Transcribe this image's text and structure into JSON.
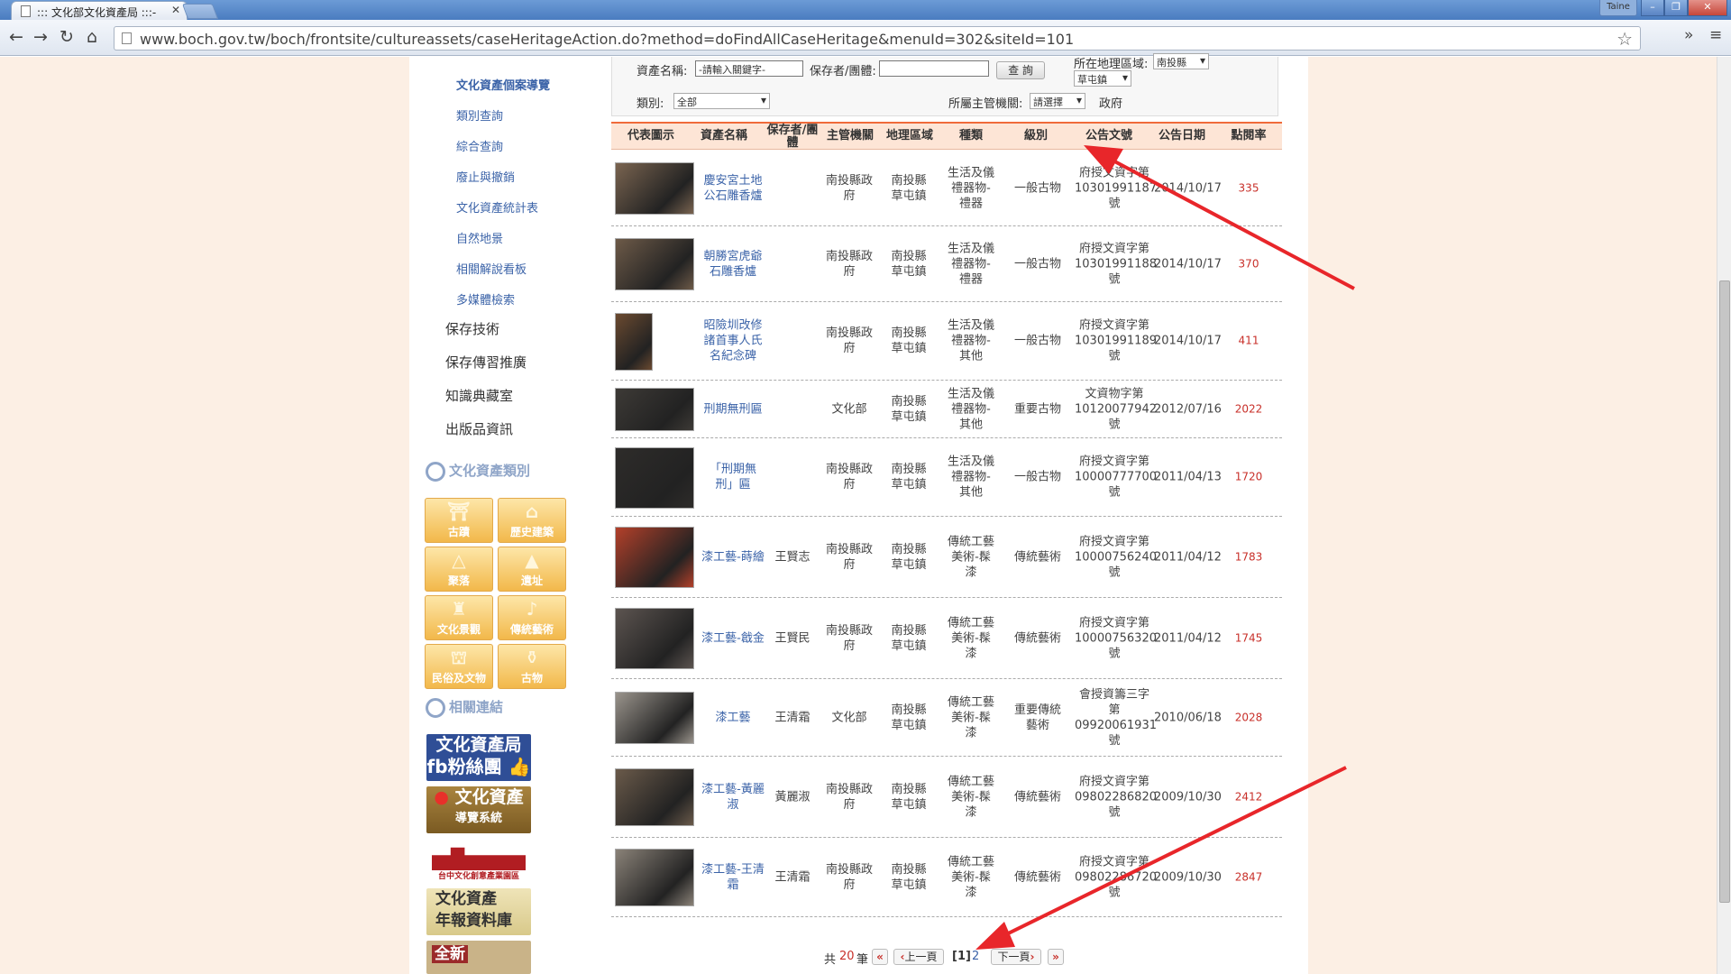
{
  "browser": {
    "tab_title": "::: 文化部文化資產局 :::-",
    "url": "www.boch.gov.tw/boch/frontsite/cultureassets/caseHeritageAction.do?method=doFindAllCaseHeritage&menuId=302&siteId=101",
    "user": "Taine"
  },
  "sidebar": {
    "sub_items": [
      "文化資產個案導覽",
      "類別查詢",
      "綜合查詢",
      "廢止與撤銷",
      "文化資產統計表",
      "自然地景",
      "相關解說看板",
      "多媒體檢索"
    ],
    "main_items": [
      "保存技術",
      "保存傳習推廣",
      "知識典藏室",
      "出版品資訊"
    ],
    "section_category": "文化資產類別",
    "categories": [
      "古蹟",
      "歷史建築",
      "聚落",
      "遺址",
      "文化景觀",
      "傳統藝術",
      "民俗及文物",
      "古物"
    ],
    "section_links": "相關連結",
    "banners": {
      "fb_line1": "文化資產局",
      "fb_line2": "fb粉絲團",
      "guide_line1": "文化資產",
      "guide_line2": "導覽系統",
      "library": "台中文化創意產業園區",
      "yearbook_line1": "文化資產",
      "yearbook_line2": "年報資料庫",
      "new": "全新"
    }
  },
  "filters": {
    "name_label": "資產名稱:",
    "name_placeholder": "-請輸入關鍵字-",
    "keeper_label": "保存者/團體:",
    "search_button": "查 詢",
    "region_label": "所在地理區域:",
    "county": "南投縣",
    "town": "草屯鎮",
    "category_label": "類別:",
    "category_value": "全部",
    "agency_label": "所屬主管機關:",
    "agency_value": "請選擇",
    "agency_text": "政府"
  },
  "table": {
    "headers": [
      "代表圖示",
      "資產名稱",
      "保存者/團體",
      "主管機關",
      "地理區域",
      "種類",
      "級別",
      "公告文號",
      "公告日期",
      "點閱率"
    ],
    "rows": [
      {
        "name": "慶安宮土地公石雕香爐",
        "keeper": "",
        "agency": "南投縣政府",
        "region": "南投縣草屯鎮",
        "type": "生活及儀禮器物-禮器",
        "level": "一般古物",
        "doc": "府授文資字第10301991187號",
        "date": "2014/10/17",
        "clicks": "335"
      },
      {
        "name": "朝勝宮虎爺石雕香爐",
        "keeper": "",
        "agency": "南投縣政府",
        "region": "南投縣草屯鎮",
        "type": "生活及儀禮器物-禮器",
        "level": "一般古物",
        "doc": "府授文資字第10301991188號",
        "date": "2014/10/17",
        "clicks": "370"
      },
      {
        "name": "昭險圳改修諸首事人氏名紀念碑",
        "keeper": "",
        "agency": "南投縣政府",
        "region": "南投縣草屯鎮",
        "type": "生活及儀禮器物-其他",
        "level": "一般古物",
        "doc": "府授文資字第10301991189號",
        "date": "2014/10/17",
        "clicks": "411"
      },
      {
        "name": "刑期無刑匾",
        "keeper": "",
        "agency": "文化部",
        "region": "南投縣草屯鎮",
        "type": "生活及儀禮器物-其他",
        "level": "重要古物",
        "doc": "文資物字第10120077942號",
        "date": "2012/07/16",
        "clicks": "2022"
      },
      {
        "name": "「刑期無刑」匾",
        "keeper": "",
        "agency": "南投縣政府",
        "region": "南投縣草屯鎮",
        "type": "生活及儀禮器物-其他",
        "level": "一般古物",
        "doc": "府授文資字第10000777700號",
        "date": "2011/04/13",
        "clicks": "1720"
      },
      {
        "name": "漆工藝-蒔繪",
        "keeper": "王賢志",
        "agency": "南投縣政府",
        "region": "南投縣草屯鎮",
        "type": "傳統工藝美術-髹漆",
        "level": "傳統藝術",
        "doc": "府授文資字第10000756240號",
        "date": "2011/04/12",
        "clicks": "1783"
      },
      {
        "name": "漆工藝-戧金",
        "keeper": "王賢民",
        "agency": "南投縣政府",
        "region": "南投縣草屯鎮",
        "type": "傳統工藝美術-髹漆",
        "level": "傳統藝術",
        "doc": "府授文資字第10000756320號",
        "date": "2011/04/12",
        "clicks": "1745"
      },
      {
        "name": "漆工藝",
        "keeper": "王清霜",
        "agency": "文化部",
        "region": "南投縣草屯鎮",
        "type": "傳統工藝美術-髹漆",
        "level": "重要傳統藝術",
        "doc": "會授資籌三字第09920061931號",
        "date": "2010/06/18",
        "clicks": "2028"
      },
      {
        "name": "漆工藝-黃麗淑",
        "keeper": "黃麗淑",
        "agency": "南投縣政府",
        "region": "南投縣草屯鎮",
        "type": "傳統工藝美術-髹漆",
        "level": "傳統藝術",
        "doc": "府授文資字第09802286820號",
        "date": "2009/10/30",
        "clicks": "2412"
      },
      {
        "name": "漆工藝-王清霜",
        "keeper": "王清霜",
        "agency": "南投縣政府",
        "region": "南投縣草屯鎮",
        "type": "傳統工藝美術-髹漆",
        "level": "傳統藝術",
        "doc": "府授文資字第09802286720號",
        "date": "2009/10/30",
        "clicks": "2847"
      }
    ]
  },
  "pager": {
    "total_prefix": "共",
    "total": "20",
    "total_suffix": "筆",
    "prev": "上一頁",
    "current": "[1]",
    "page2": "2",
    "next": "下一頁"
  },
  "annotation_color": "#e8262a"
}
